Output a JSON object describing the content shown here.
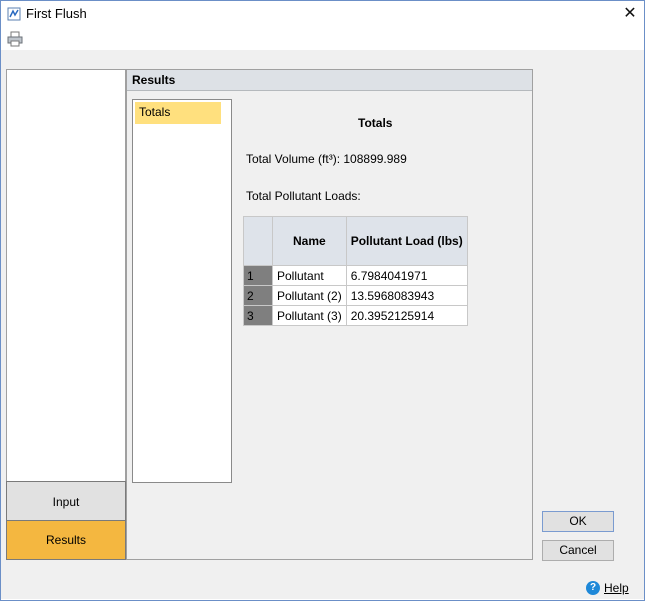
{
  "window": {
    "title": "First Flush",
    "close_glyph": "✕"
  },
  "nav": {
    "input_label": "Input",
    "results_label": "Results"
  },
  "panel": {
    "header": "Results",
    "tree_items": [
      "Totals"
    ]
  },
  "report": {
    "title": "Totals",
    "volume_label": "Total Volume (ft³):",
    "volume_value": "108899.989",
    "loads_label": "Total Pollutant Loads:",
    "columns": [
      "Name",
      "Pollutant Load (lbs)"
    ],
    "rows": [
      {
        "index": "1",
        "name": "Pollutant",
        "load": "6.7984041971"
      },
      {
        "index": "2",
        "name": "Pollutant (2)",
        "load": "13.5968083943"
      },
      {
        "index": "3",
        "name": "Pollutant (3)",
        "load": "20.3952125914"
      }
    ]
  },
  "buttons": {
    "ok": "OK",
    "cancel": "Cancel",
    "help": "Help",
    "help_glyph": "?"
  },
  "colors": {
    "selected_nav": "#f4b740",
    "selected_tree": "#ffe07e",
    "row_header": "#7f7f7f"
  }
}
